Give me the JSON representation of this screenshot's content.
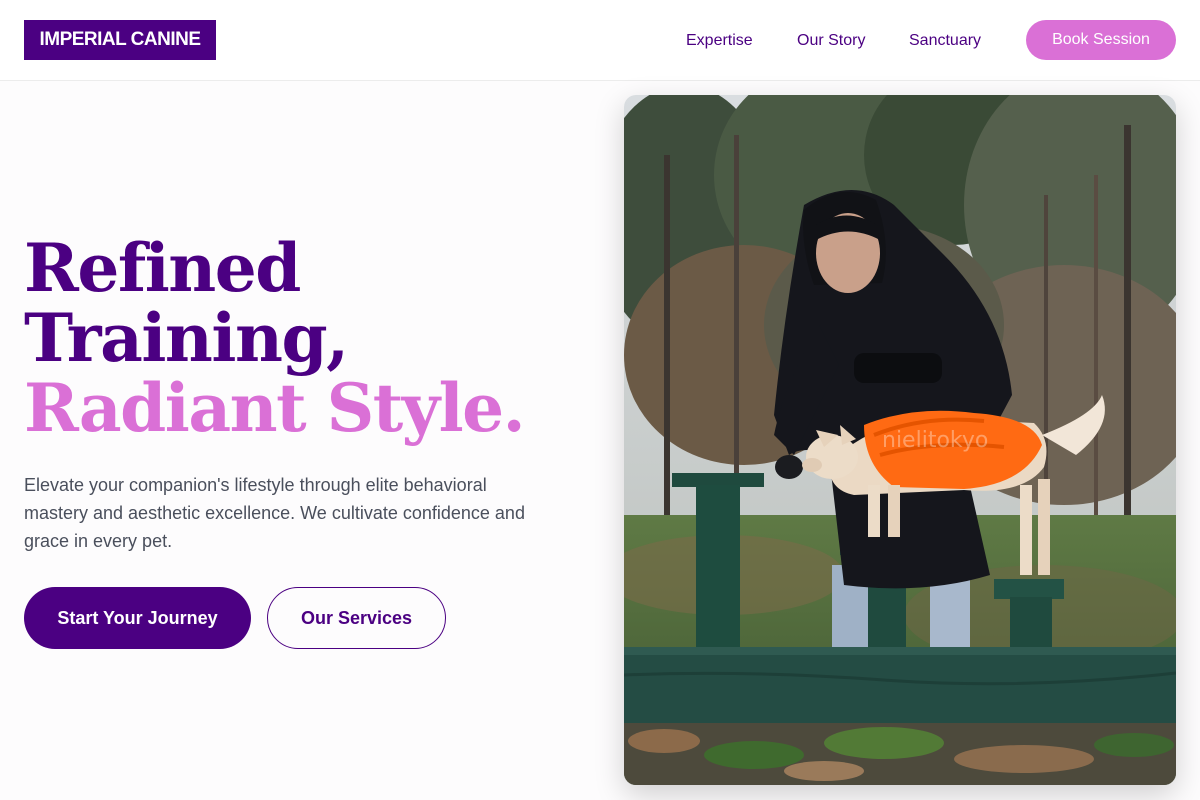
{
  "header": {
    "logo": "IMPERIAL CANINE",
    "nav": [
      {
        "label": "Expertise"
      },
      {
        "label": "Our Story"
      },
      {
        "label": "Sanctuary"
      }
    ],
    "cta_label": "Book Session"
  },
  "hero": {
    "title_line1": "Refined",
    "title_line2": "Training,",
    "title_line3": "Radiant Style.",
    "description": "Elevate your companion's lifestyle through elite behavioral mastery and aesthetic excellence. We cultivate confidence and grace in every pet.",
    "primary_button": "Start Your Journey",
    "secondary_button": "Our Services",
    "image_watermark": "nielitokyo"
  },
  "colors": {
    "brand_purple": "#4b0082",
    "accent_orchid": "#da70d6",
    "body_text": "#4a4f5c"
  }
}
